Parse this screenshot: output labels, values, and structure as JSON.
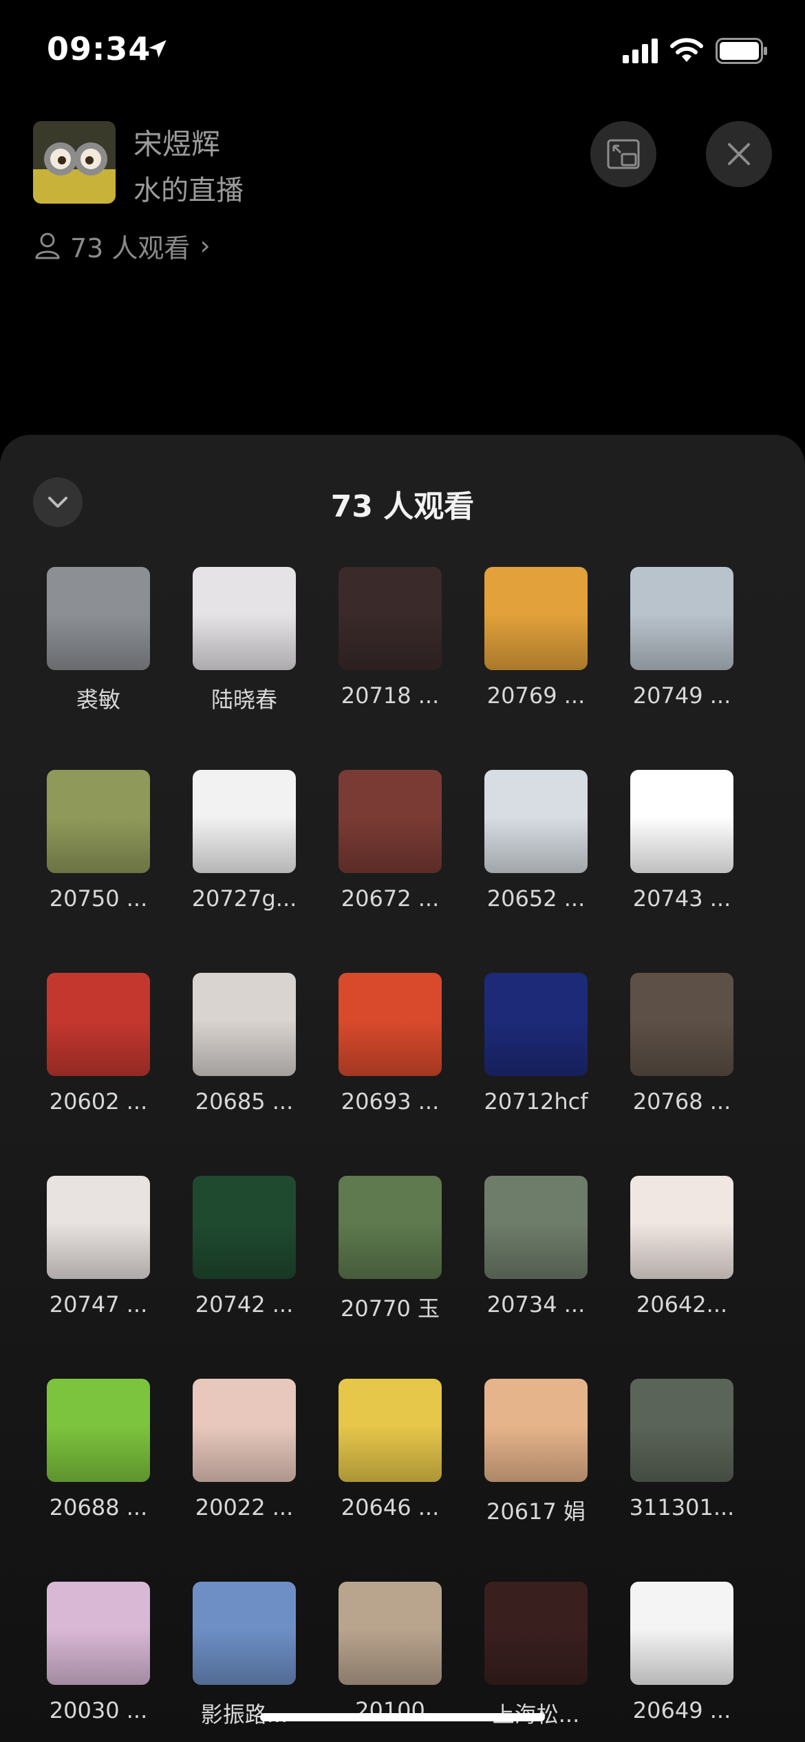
{
  "status": {
    "time": "09:34"
  },
  "header": {
    "host_name": "宋煜辉",
    "live_title": "水的直播",
    "viewer_count": "73 人观看"
  },
  "sheet": {
    "title": "73 人观看"
  },
  "viewers": [
    {
      "label": "裘敏",
      "bg": "#8c8f94"
    },
    {
      "label": "陆晓春",
      "bg": "#e6e3e6"
    },
    {
      "label": "20718 ...",
      "bg": "#3a2a2a"
    },
    {
      "label": "20769 ...",
      "bg": "#e2a13a"
    },
    {
      "label": "20749 ...",
      "bg": "#b9c3cc"
    },
    {
      "label": "20750 ...",
      "bg": "#8f9a5a"
    },
    {
      "label": "20727g...",
      "bg": "#f2f2f2"
    },
    {
      "label": "20672 ...",
      "bg": "#7a3b34"
    },
    {
      "label": "20652 ...",
      "bg": "#d7dde3"
    },
    {
      "label": "20743 ...",
      "bg": "#ffffff"
    },
    {
      "label": "20602 ...",
      "bg": "#c4372f"
    },
    {
      "label": "20685 ...",
      "bg": "#d9d4d0"
    },
    {
      "label": "20693 ...",
      "bg": "#d94a2c"
    },
    {
      "label": "20712hcf",
      "bg": "#1d2a78"
    },
    {
      "label": "20768 ...",
      "bg": "#5d5046"
    },
    {
      "label": "20747 ...",
      "bg": "#e8e2e0"
    },
    {
      "label": "20742 ...",
      "bg": "#1f4a30"
    },
    {
      "label": "20770 玉",
      "bg": "#5e7a4e"
    },
    {
      "label": "20734 ...",
      "bg": "#6e7c6a"
    },
    {
      "label": "20642...",
      "bg": "#f0e6e2"
    },
    {
      "label": "20688 ...",
      "bg": "#7dc43e"
    },
    {
      "label": "20022 ...",
      "bg": "#e8c8bc"
    },
    {
      "label": "20646 ...",
      "bg": "#e6c74a"
    },
    {
      "label": "20617 娟",
      "bg": "#e6b48a"
    },
    {
      "label": "311301...",
      "bg": "#5b6458"
    },
    {
      "label": "20030 ...",
      "bg": "#d9b8d6"
    },
    {
      "label": "影振路...",
      "bg": "#6d8fc6"
    },
    {
      "label": "20100",
      "bg": "#b9a48e"
    },
    {
      "label": "上海松...",
      "bg": "#3a1f1f"
    },
    {
      "label": "20649 ...",
      "bg": "#f4f4f4"
    }
  ]
}
